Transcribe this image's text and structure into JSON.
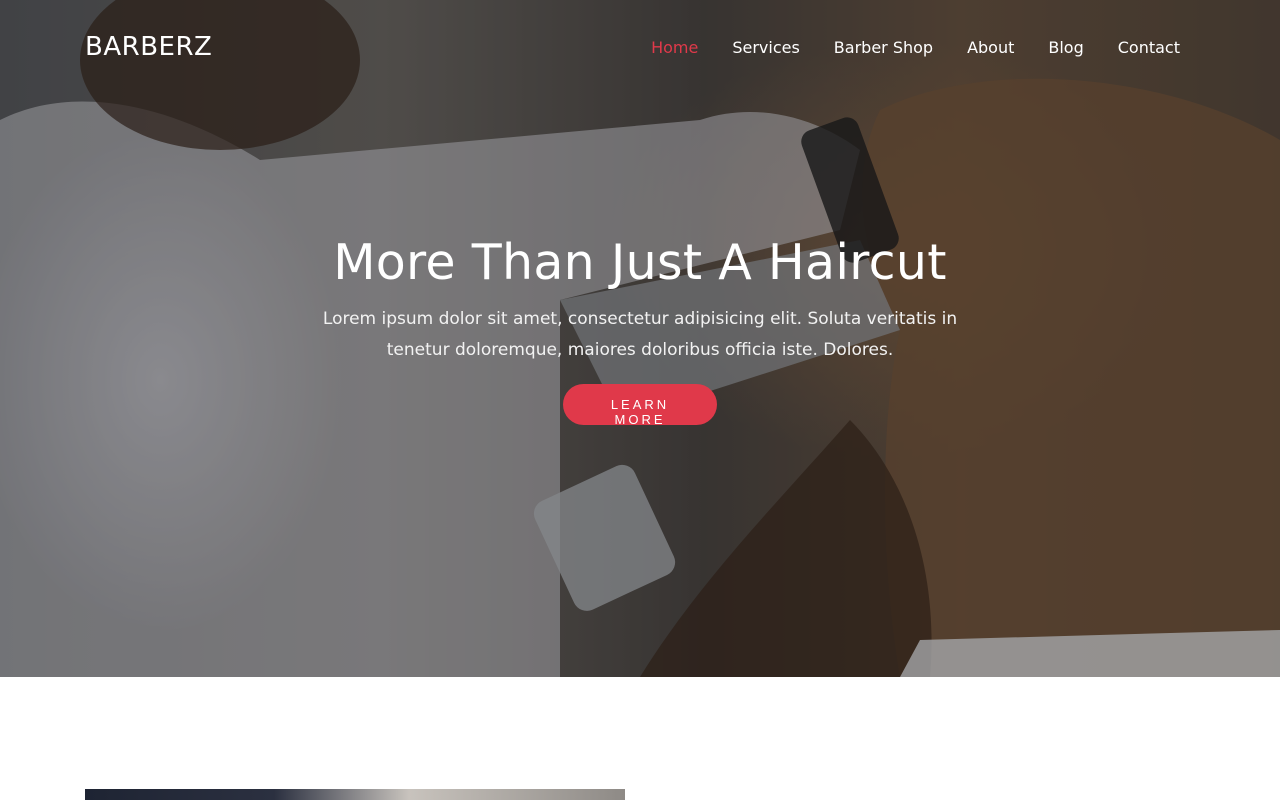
{
  "brand": {
    "name": "BARBERZ"
  },
  "nav": {
    "items": [
      {
        "label": "Home",
        "active": true
      },
      {
        "label": "Services",
        "active": false
      },
      {
        "label": "Barber Shop",
        "active": false
      },
      {
        "label": "About",
        "active": false
      },
      {
        "label": "Blog",
        "active": false
      },
      {
        "label": "Contact",
        "active": false
      }
    ]
  },
  "hero": {
    "title": "More Than Just A Haircut",
    "text": "Lorem ipsum dolor sit amet, consectetur adipisicing elit. Soluta veritatis in tenetur doloremque, maiores doloribus officia iste. Dolores.",
    "cta_label": "Learn More"
  },
  "colors": {
    "accent": "#e0394a",
    "text_light": "#ffffff"
  }
}
